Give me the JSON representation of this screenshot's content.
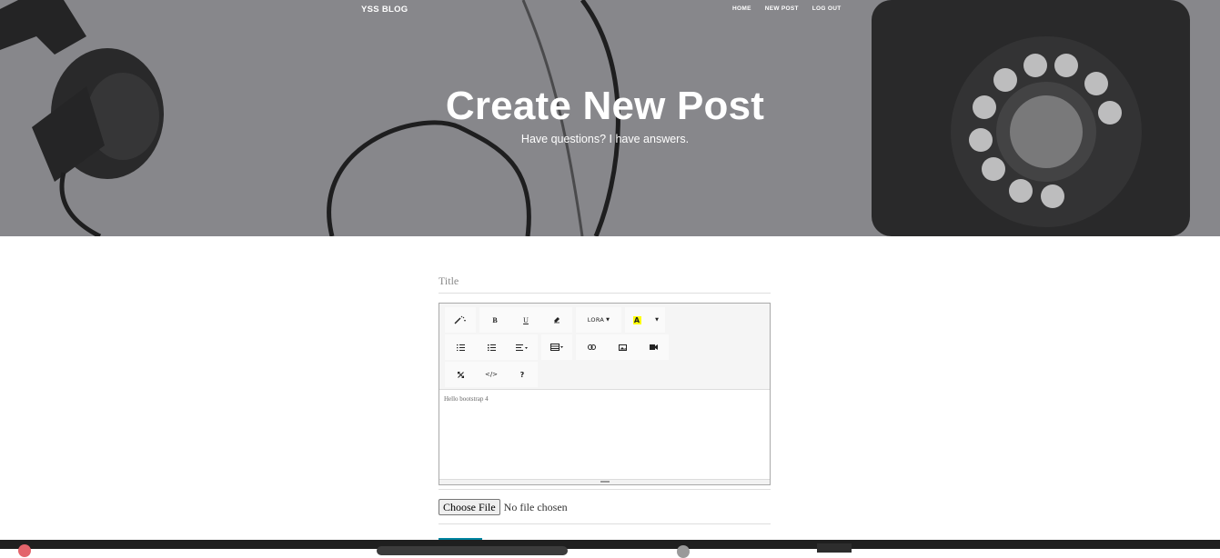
{
  "header": {
    "brand": "YSS BLOG",
    "nav": [
      {
        "label": "HOME"
      },
      {
        "label": "NEW POST"
      },
      {
        "label": "LOG OUT"
      }
    ],
    "title": "Create New Post",
    "subtitle": "Have questions? I have answers."
  },
  "form": {
    "title_placeholder": "Title",
    "editor": {
      "toolbar": {
        "row1": [
          {
            "icon": "magic-wand-style-icon"
          },
          {
            "label": "B",
            "icon": "bold-icon"
          },
          {
            "label": "U",
            "icon": "underline-icon"
          },
          {
            "icon": "eraser-icon"
          },
          {
            "label": "LORA",
            "icon": "font-family-dropdown"
          },
          {
            "label": "A",
            "icon": "highlight-color-icon"
          }
        ],
        "row2": [
          {
            "icon": "unordered-list-icon"
          },
          {
            "icon": "ordered-list-icon"
          },
          {
            "icon": "align-dropdown-icon"
          },
          {
            "icon": "table-dropdown-icon"
          },
          {
            "icon": "link-icon"
          },
          {
            "icon": "image-icon"
          },
          {
            "icon": "video-icon"
          }
        ],
        "row3": [
          {
            "icon": "fullscreen-icon"
          },
          {
            "label": "</>",
            "icon": "code-view-icon"
          },
          {
            "label": "?",
            "icon": "help-icon"
          }
        ]
      },
      "content": "Hello bootstrap 4"
    },
    "file": {
      "button_label": "Choose File",
      "status": "No file chosen"
    }
  },
  "colors": {
    "hero_bg": "#8b8b8d",
    "text_white": "#ffffff",
    "submit_accent": "#0085a1",
    "highlight_yellow": "#ffff00"
  }
}
